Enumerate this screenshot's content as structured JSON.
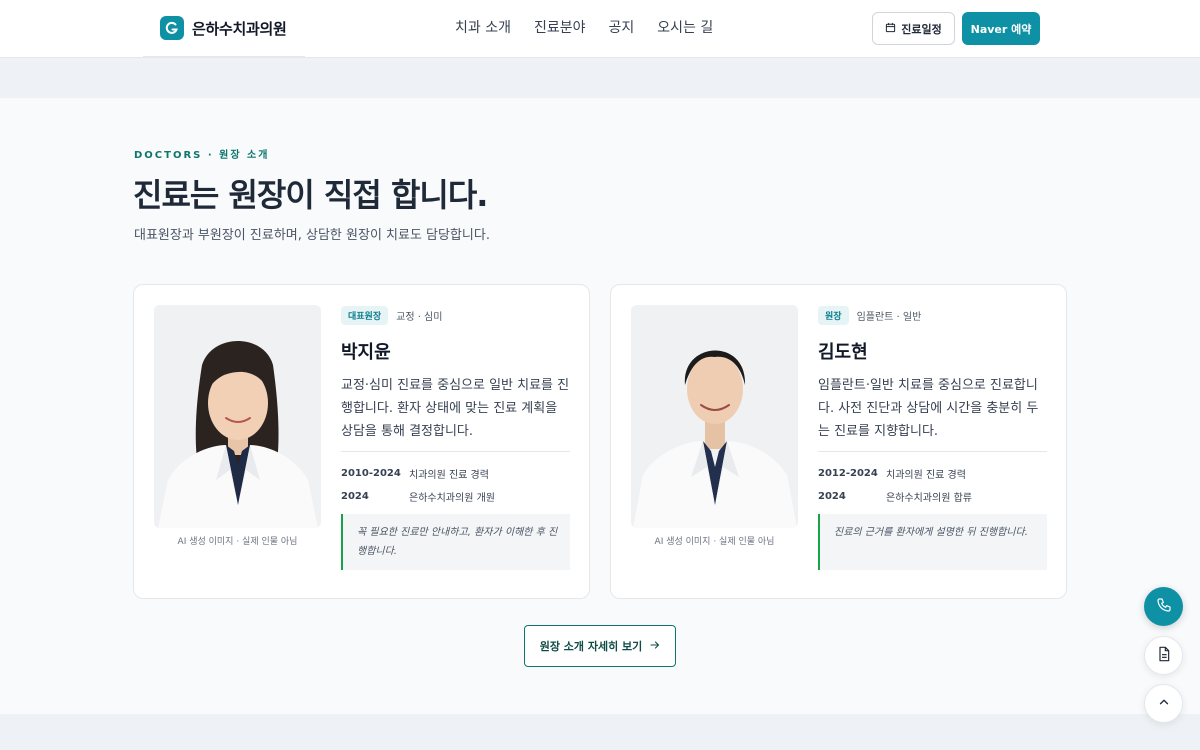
{
  "header": {
    "brand": "은하수치과의원",
    "nav": [
      "치과 소개",
      "진료분야",
      "공지",
      "오시는 길"
    ],
    "schedule_label": "진료일정",
    "naver_label": "Naver 예약"
  },
  "section": {
    "eyebrow": "DOCTORS · 원장 소개",
    "title": "진료는 원장이 직접 합니다.",
    "subtitle": "대표원장과 부원장이 진료하며, 상담한 원장이 치료도 담당합니다.",
    "more_label": "원장 소개 자세히 보기"
  },
  "doctors": [
    {
      "role": "대표원장",
      "spec": "교정 · 심미",
      "name": "박지윤",
      "desc": "교정·심미 진료를 중심으로 일반 치료를 진행합니다. 환자 상태에 맞는 진료 계획을 상담을 통해 결정합니다.",
      "career": [
        {
          "year": "2010-2024",
          "text": "치과의원 진료 경력"
        },
        {
          "year": "2024",
          "text": "은하수치과의원 개원"
        }
      ],
      "quote": "꼭 필요한 진료만 안내하고, 환자가 이해한 후 진행합니다.",
      "caption": "AI 생성 이미지 · 실제 인물 아님"
    },
    {
      "role": "원장",
      "spec": "임플란트 · 일반",
      "name": "김도현",
      "desc": "임플란트·일반 치료를 중심으로 진료합니다. 사전 진단과 상담에 시간을 충분히 두는 진료를 지향합니다.",
      "career": [
        {
          "year": "2012-2024",
          "text": "치과의원 진료 경력"
        },
        {
          "year": "2024",
          "text": "은하수치과의원 합류"
        }
      ],
      "quote": "진료의 근거를 환자에게 설명한 뒤 진행합니다.",
      "caption": "AI 생성 이미지 · 실제 인물 아님"
    }
  ],
  "colors": {
    "accent": "#0e91a4",
    "eyebrow": "#0f766e",
    "quote_border": "#16a34a"
  },
  "icons": {
    "calendar": "calendar-icon",
    "arrow": "arrow-right-icon",
    "phone": "phone-icon",
    "document": "document-icon",
    "up": "chevron-up-icon"
  }
}
